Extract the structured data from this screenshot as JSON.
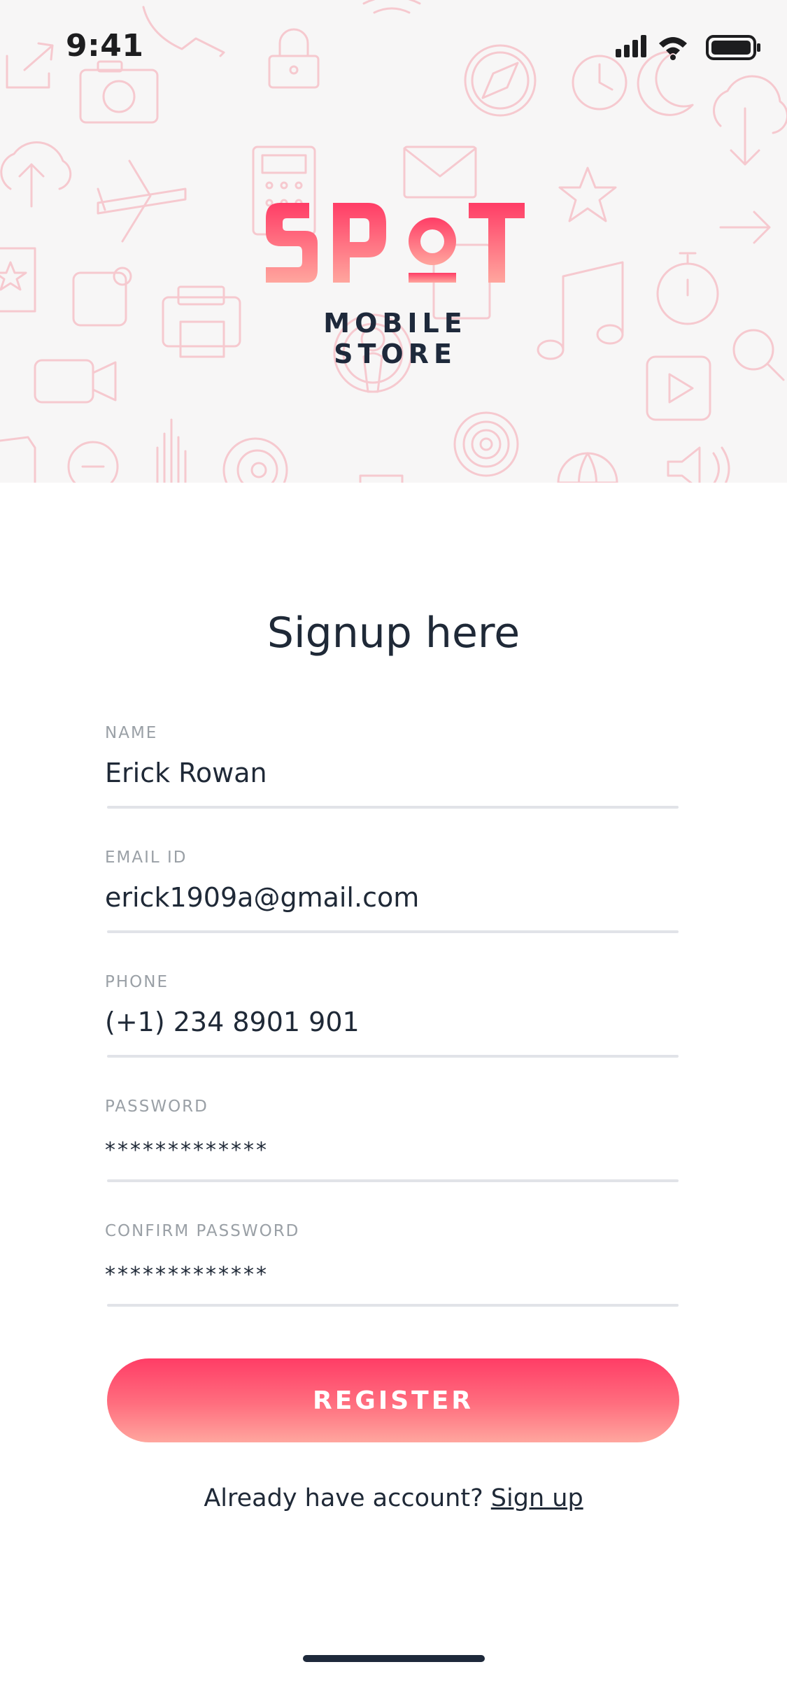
{
  "status_bar": {
    "time": "9:41"
  },
  "brand": {
    "logo_text": "SPOT",
    "subtitle": "MOBILE STORE"
  },
  "form": {
    "title": "Signup here",
    "fields": [
      {
        "label": "NAME",
        "value": "Erick Rowan"
      },
      {
        "label": "EMAIL ID",
        "value": "erick1909a@gmail.com"
      },
      {
        "label": "PHONE",
        "value": "(+1) 234 8901 901"
      },
      {
        "label": "PASSWORD",
        "value": "*************"
      },
      {
        "label": "CONFIRM PASSWORD",
        "value": "*************"
      }
    ],
    "register_label": "REGISTER"
  },
  "footer": {
    "prompt": "Already have account? ",
    "link_label": "Sign up"
  },
  "colors": {
    "accent_top": "#ff3d66",
    "accent_bottom": "#ffa69e",
    "text_dark": "#1f2937",
    "label_gray": "#9aa0a6",
    "hero_bg": "#f7f6f6",
    "pattern": "#f6c9cf"
  }
}
